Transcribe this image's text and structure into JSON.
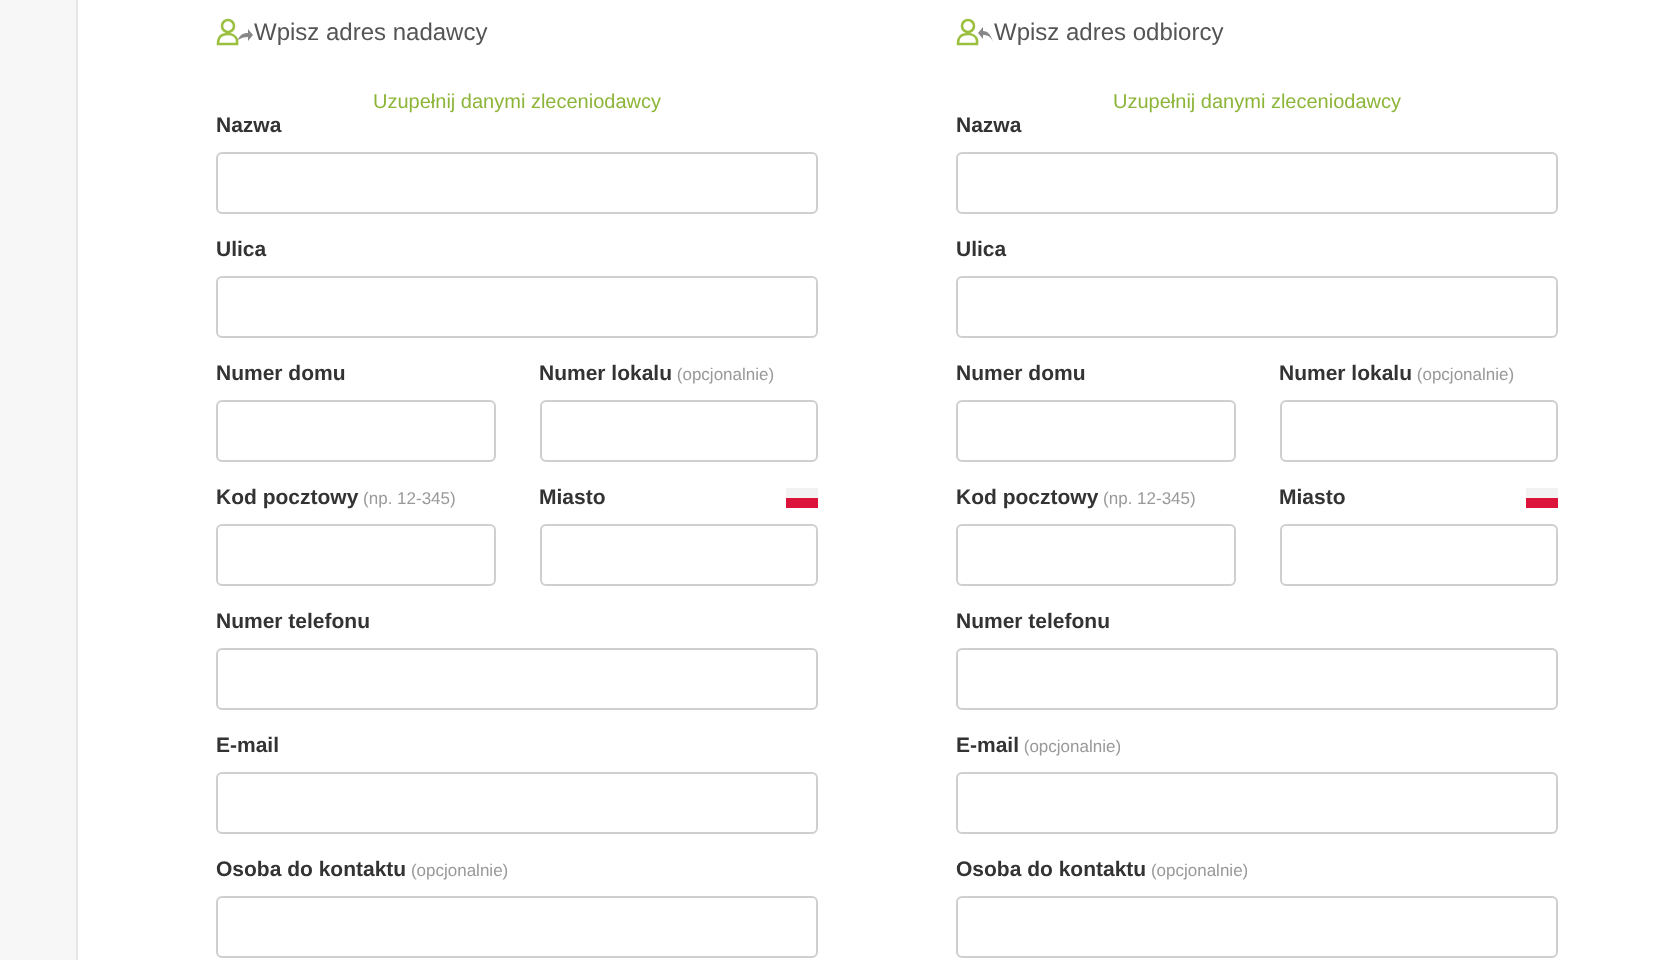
{
  "sections": [
    {
      "kind": "sender",
      "title": "Wpisz adres nadawcy",
      "fill_link": "Uzupełnij danymi zleceniodawcy",
      "rows": [
        [
          {
            "label": "Nazwa"
          }
        ],
        [
          {
            "label": "Ulica"
          }
        ],
        [
          {
            "label": "Numer domu"
          },
          {
            "label": "Numer lokalu",
            "hint": "(opcjonalnie)"
          }
        ],
        [
          {
            "label": "Kod pocztowy",
            "hint": "(np. 12-345)"
          },
          {
            "label": "Miasto",
            "flag": true
          }
        ],
        [
          {
            "label": "Numer telefonu"
          }
        ],
        [
          {
            "label": "E-mail"
          }
        ],
        [
          {
            "label": "Osoba do kontaktu",
            "hint": "(opcjonalnie)"
          }
        ]
      ]
    },
    {
      "kind": "recipient",
      "title": "Wpisz adres odbiorcy",
      "fill_link": "Uzupełnij danymi zleceniodawcy",
      "rows": [
        [
          {
            "label": "Nazwa"
          }
        ],
        [
          {
            "label": "Ulica"
          }
        ],
        [
          {
            "label": "Numer domu"
          },
          {
            "label": "Numer lokalu",
            "hint": "(opcjonalnie)"
          }
        ],
        [
          {
            "label": "Kod pocztowy",
            "hint": "(np. 12-345)"
          },
          {
            "label": "Miasto",
            "flag": true
          }
        ],
        [
          {
            "label": "Numer telefonu"
          }
        ],
        [
          {
            "label": "E-mail",
            "hint": "(opcjonalnie)"
          }
        ],
        [
          {
            "label": "Osoba do kontaktu",
            "hint": "(opcjonalnie)"
          }
        ]
      ]
    }
  ]
}
